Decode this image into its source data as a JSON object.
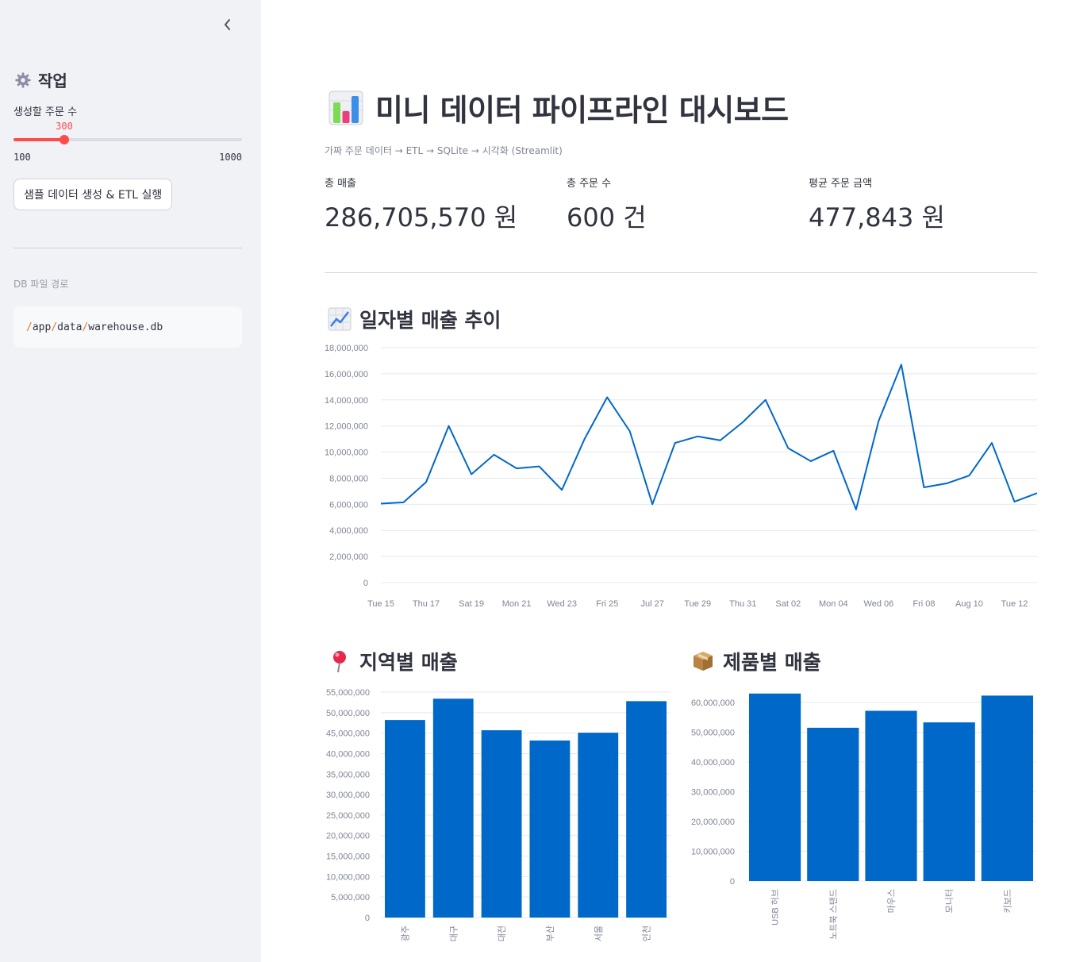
{
  "sidebar": {
    "collapse_icon": "chevron-left-icon",
    "header_icon": "gear-icon",
    "title": "작업",
    "slider": {
      "label": "생성할 주문 수",
      "value": "300",
      "min": "100",
      "max": "1000",
      "fraction": 0.2222
    },
    "run_button": "샘플 데이터 생성 & ETL 실행",
    "db_label": "DB 파일 경로",
    "db_path_parts": [
      "/",
      "app",
      "/",
      "data",
      "/",
      "warehouse.db"
    ]
  },
  "main": {
    "title_icon": "bar-chart-icon",
    "title": "미니 데이터 파이프라인 대시보드",
    "caption": "가짜 주문 데이터 → ETL → SQLite → 시각화 (Streamlit)",
    "metrics": [
      {
        "label": "총 매출",
        "value": "286,705,570 원"
      },
      {
        "label": "총 주문 수",
        "value": "600 건"
      },
      {
        "label": "평균 주문 금액",
        "value": "477,843 원"
      }
    ],
    "sections": {
      "daily": {
        "icon": "chart-increasing-icon",
        "title": "일자별 매출 추이"
      },
      "region": {
        "icon": "round-pushpin-icon",
        "title": "지역별 매출"
      },
      "product": {
        "icon": "package-icon",
        "title": "제품별 매출"
      }
    }
  },
  "colors": {
    "accent": "#ff4b4b",
    "series": "#0068c9",
    "sidebar_bg": "#f0f2f6"
  },
  "chart_data": [
    {
      "type": "line",
      "x_tick_labels": [
        "Tue 15",
        "Thu 17",
        "Sat 19",
        "Mon 21",
        "Wed 23",
        "Fri 25",
        "Jul 27",
        "Tue 29",
        "Thu 31",
        "Sat 02",
        "Mon 04",
        "Wed 06",
        "Fri 08",
        "Aug 10",
        "Tue 12"
      ],
      "x": [
        "07-15",
        "07-16",
        "07-17",
        "07-18",
        "07-19",
        "07-20",
        "07-21",
        "07-22",
        "07-23",
        "07-24",
        "07-25",
        "07-26",
        "07-27",
        "07-28",
        "07-29",
        "07-30",
        "07-31",
        "08-01",
        "08-02",
        "08-03",
        "08-04",
        "08-05",
        "08-06",
        "08-07",
        "08-08",
        "08-09",
        "08-10",
        "08-11",
        "08-12",
        "08-13"
      ],
      "values": [
        6050000,
        6150000,
        7700000,
        12000000,
        8300000,
        9800000,
        8750000,
        8900000,
        7100000,
        11000000,
        14200000,
        11600000,
        6000000,
        10700000,
        11200000,
        10900000,
        12300000,
        14000000,
        10300000,
        9300000,
        10100000,
        5600000,
        12400000,
        16700000,
        7300000,
        7600000,
        8200000,
        10700000,
        6200000,
        6850000
      ],
      "y_ticks": [
        "0",
        "2,000,000",
        "4,000,000",
        "6,000,000",
        "8,000,000",
        "10,000,000",
        "12,000,000",
        "14,000,000",
        "16,000,000",
        "18,000,000"
      ],
      "ylim": [
        0,
        18000000
      ],
      "grid": true
    },
    {
      "type": "bar",
      "categories": [
        "광주",
        "대구",
        "대전",
        "부산",
        "서울",
        "인천"
      ],
      "values": [
        48200000,
        53400000,
        45700000,
        43200000,
        45100000,
        52800000
      ],
      "y_ticks": [
        "0",
        "5,000,000",
        "10,000,000",
        "15,000,000",
        "20,000,000",
        "25,000,000",
        "30,000,000",
        "35,000,000",
        "40,000,000",
        "45,000,000",
        "50,000,000",
        "55,000,000"
      ],
      "ylim": [
        0,
        55000000
      ],
      "grid": true
    },
    {
      "type": "bar",
      "categories": [
        "USB 허브",
        "노트북 스탠드",
        "마우스",
        "모니터",
        "키보드"
      ],
      "values": [
        63000000,
        51500000,
        57200000,
        53300000,
        62300000
      ],
      "y_ticks": [
        "0",
        "10,000,000",
        "20,000,000",
        "30,000,000",
        "40,000,000",
        "50,000,000",
        "60,000,000"
      ],
      "ylim": [
        0,
        60000000
      ],
      "grid": true
    }
  ]
}
